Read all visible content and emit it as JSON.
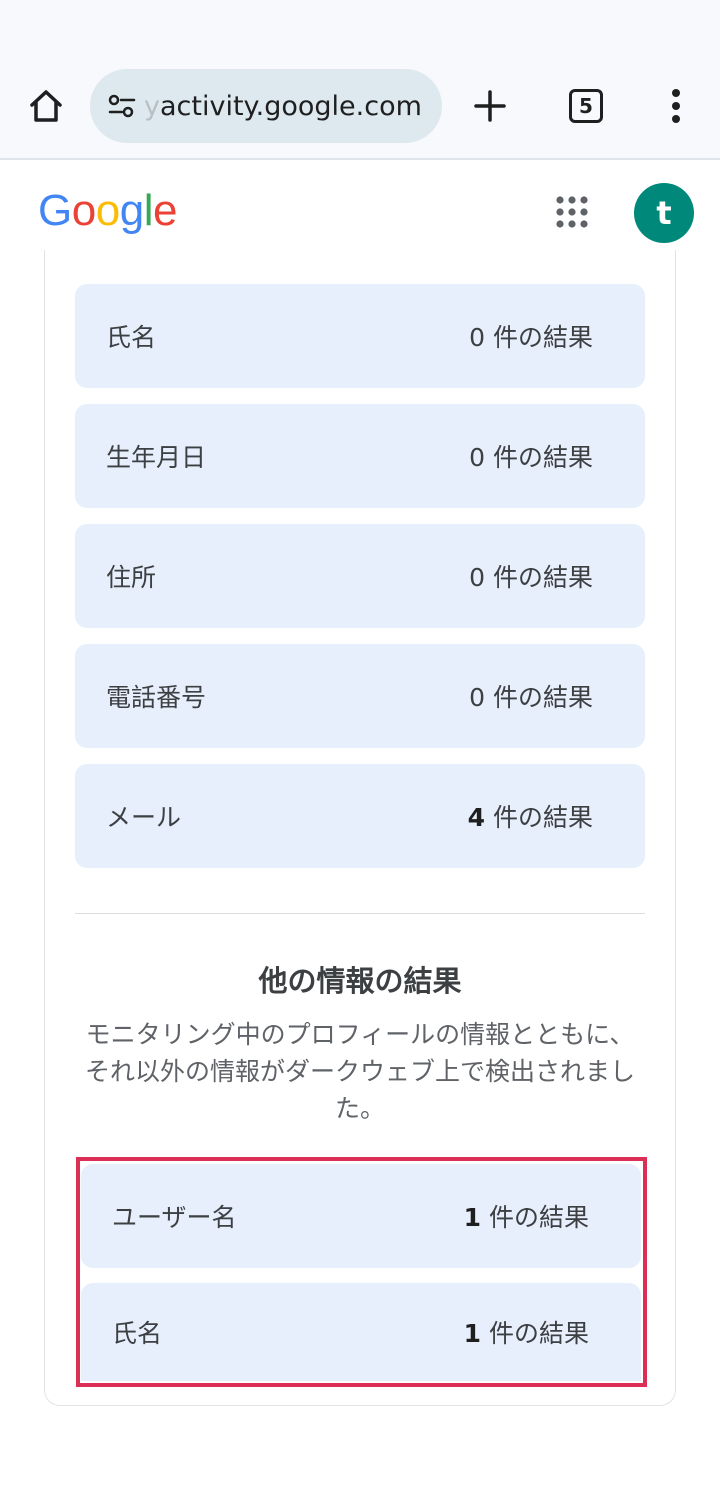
{
  "browser": {
    "url_faded": "y",
    "url": "activity.google.com",
    "tab_count": "5"
  },
  "header": {
    "logo_letters": [
      {
        "ch": "G",
        "color": "#4285F4"
      },
      {
        "ch": "o",
        "color": "#EA4335"
      },
      {
        "ch": "o",
        "color": "#FBBC05"
      },
      {
        "ch": "g",
        "color": "#4285F4"
      },
      {
        "ch": "l",
        "color": "#34A853"
      },
      {
        "ch": "e",
        "color": "#EA4335"
      }
    ],
    "avatar_initial": "t",
    "avatar_color": "#00897B"
  },
  "profile_results": [
    {
      "label": "氏名",
      "num": "0",
      "suffix": " 件の結果"
    },
    {
      "label": "生年月日",
      "num": "0",
      "suffix": " 件の結果"
    },
    {
      "label": "住所",
      "num": "0",
      "suffix": " 件の結果"
    },
    {
      "label": "電話番号",
      "num": "0",
      "suffix": " 件の結果"
    },
    {
      "label": "メール",
      "num": "4",
      "suffix": " 件の結果"
    }
  ],
  "other_section": {
    "title": "他の情報の結果",
    "description": "モニタリング中のプロフィールの情報とともに、それ以外の情報がダークウェブ上で検出されました。",
    "results": [
      {
        "label": "ユーザー名",
        "num": "1",
        "suffix": " 件の結果"
      },
      {
        "label": "氏名",
        "num": "1",
        "suffix": " 件の結果"
      }
    ]
  },
  "colors": {
    "row_bg": "#E8EFFC",
    "highlight": "#DC2F55"
  }
}
